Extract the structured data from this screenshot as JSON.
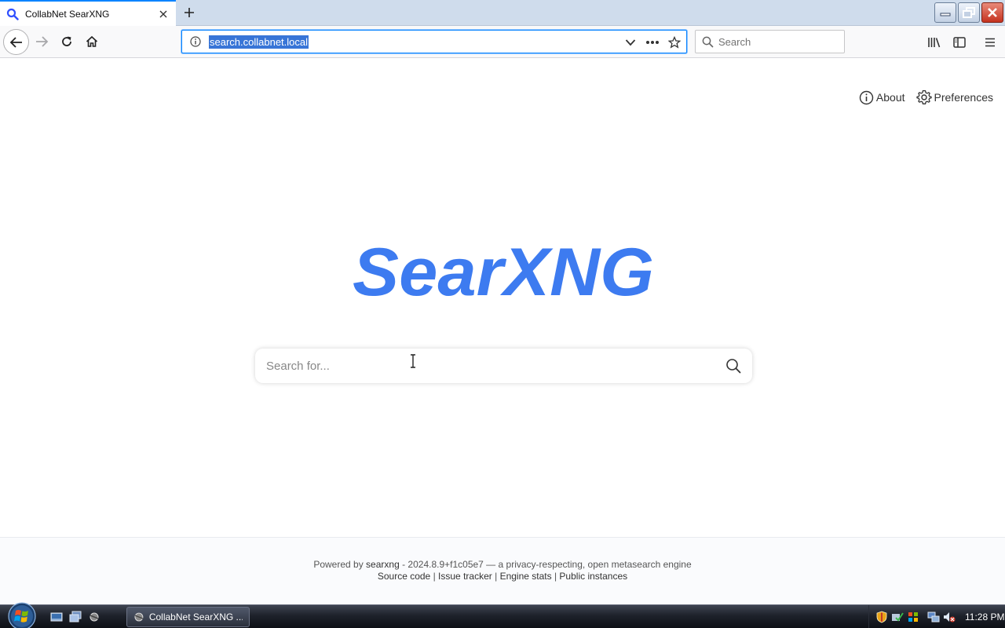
{
  "browser": {
    "tab_title": "CollabNet SearXNG",
    "url": "search.collabnet.local",
    "search_placeholder": "Search"
  },
  "page": {
    "about_label": "About",
    "preferences_label": "Preferences",
    "logo_text": "SearXNG",
    "search_placeholder": "Search for...",
    "footer": {
      "powered_by": "Powered by",
      "searxng_link": "searxng",
      "version_text": "- 2024.8.9+f1c05e7 — a privacy-respecting, open metasearch engine",
      "source_code": "Source code",
      "issue_tracker": "Issue tracker",
      "engine_stats": "Engine stats",
      "public_instances": "Public instances",
      "separator": "|"
    }
  },
  "taskbar": {
    "active_window": "CollabNet SearXNG ...",
    "clock": "11:28 PM"
  },
  "colors": {
    "accent": "#0a84ff",
    "logo_blue": "#3d7bf0",
    "url_selection": "#3875d7"
  },
  "icons": [
    "searxng-favicon",
    "close-icon",
    "plus-icon",
    "back-arrow-icon",
    "forward-arrow-icon",
    "reload-icon",
    "home-icon",
    "info-icon",
    "chevron-down-icon",
    "more-icon",
    "star-icon",
    "search-icon",
    "library-icon",
    "sidebar-icon",
    "menu-icon",
    "gear-icon",
    "windows-start-icon"
  ]
}
